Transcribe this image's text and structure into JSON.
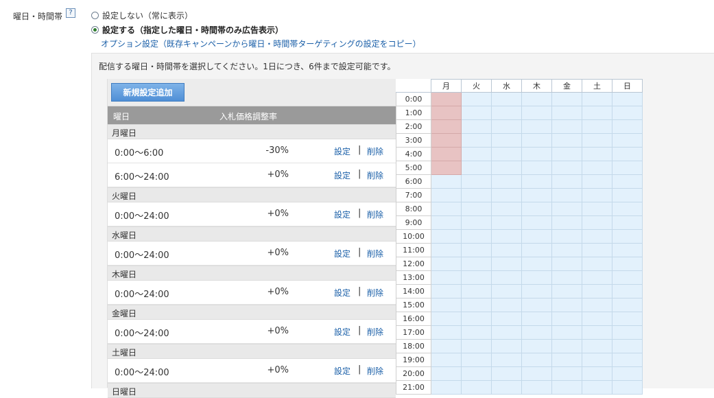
{
  "field": {
    "label": "曜日・時間帯",
    "help_text": "?"
  },
  "options": {
    "no_setting": "設定しない（常に表示）",
    "setting": "設定する（指定した曜日・時間帯のみ広告表示）",
    "option_link": "オプション設定（既存キャンペーンから曜日・時間帯ターゲティングの設定をコピー）"
  },
  "instruction": "配信する曜日・時間帯を選択してください。1日につき、6件まで設定可能です。",
  "list": {
    "add_button": "新規設定追加",
    "col_day": "曜日",
    "col_adjust": "入札価格調整率",
    "set_label": "設定",
    "delete_label": "削除",
    "separator": "|",
    "days": [
      {
        "name": "月曜日",
        "rows": [
          {
            "time": "0:00～6:00",
            "adj": "-30%"
          },
          {
            "time": "6:00～24:00",
            "adj": "+0%"
          }
        ]
      },
      {
        "name": "火曜日",
        "rows": [
          {
            "time": "0:00～24:00",
            "adj": "+0%"
          }
        ]
      },
      {
        "name": "水曜日",
        "rows": [
          {
            "time": "0:00～24:00",
            "adj": "+0%"
          }
        ]
      },
      {
        "name": "木曜日",
        "rows": [
          {
            "time": "0:00～24:00",
            "adj": "+0%"
          }
        ]
      },
      {
        "name": "金曜日",
        "rows": [
          {
            "time": "0:00～24:00",
            "adj": "+0%"
          }
        ]
      },
      {
        "name": "土曜日",
        "rows": [
          {
            "time": "0:00～24:00",
            "adj": "+0%"
          }
        ]
      },
      {
        "name": "日曜日",
        "rows": []
      }
    ]
  },
  "grid": {
    "days": [
      "月",
      "火",
      "水",
      "木",
      "金",
      "土",
      "日"
    ],
    "hours": [
      "0:00",
      "1:00",
      "2:00",
      "3:00",
      "4:00",
      "5:00",
      "6:00",
      "7:00",
      "8:00",
      "9:00",
      "10:00",
      "11:00",
      "12:00",
      "13:00",
      "14:00",
      "15:00",
      "16:00",
      "17:00",
      "18:00",
      "19:00",
      "20:00",
      "21:00"
    ],
    "highlighted": {
      "day_index": 0,
      "hours": [
        0,
        1,
        2,
        3,
        4,
        5
      ]
    },
    "colors": {
      "normal": "#e3f1fc",
      "highlight": "#e8c3c3"
    }
  }
}
